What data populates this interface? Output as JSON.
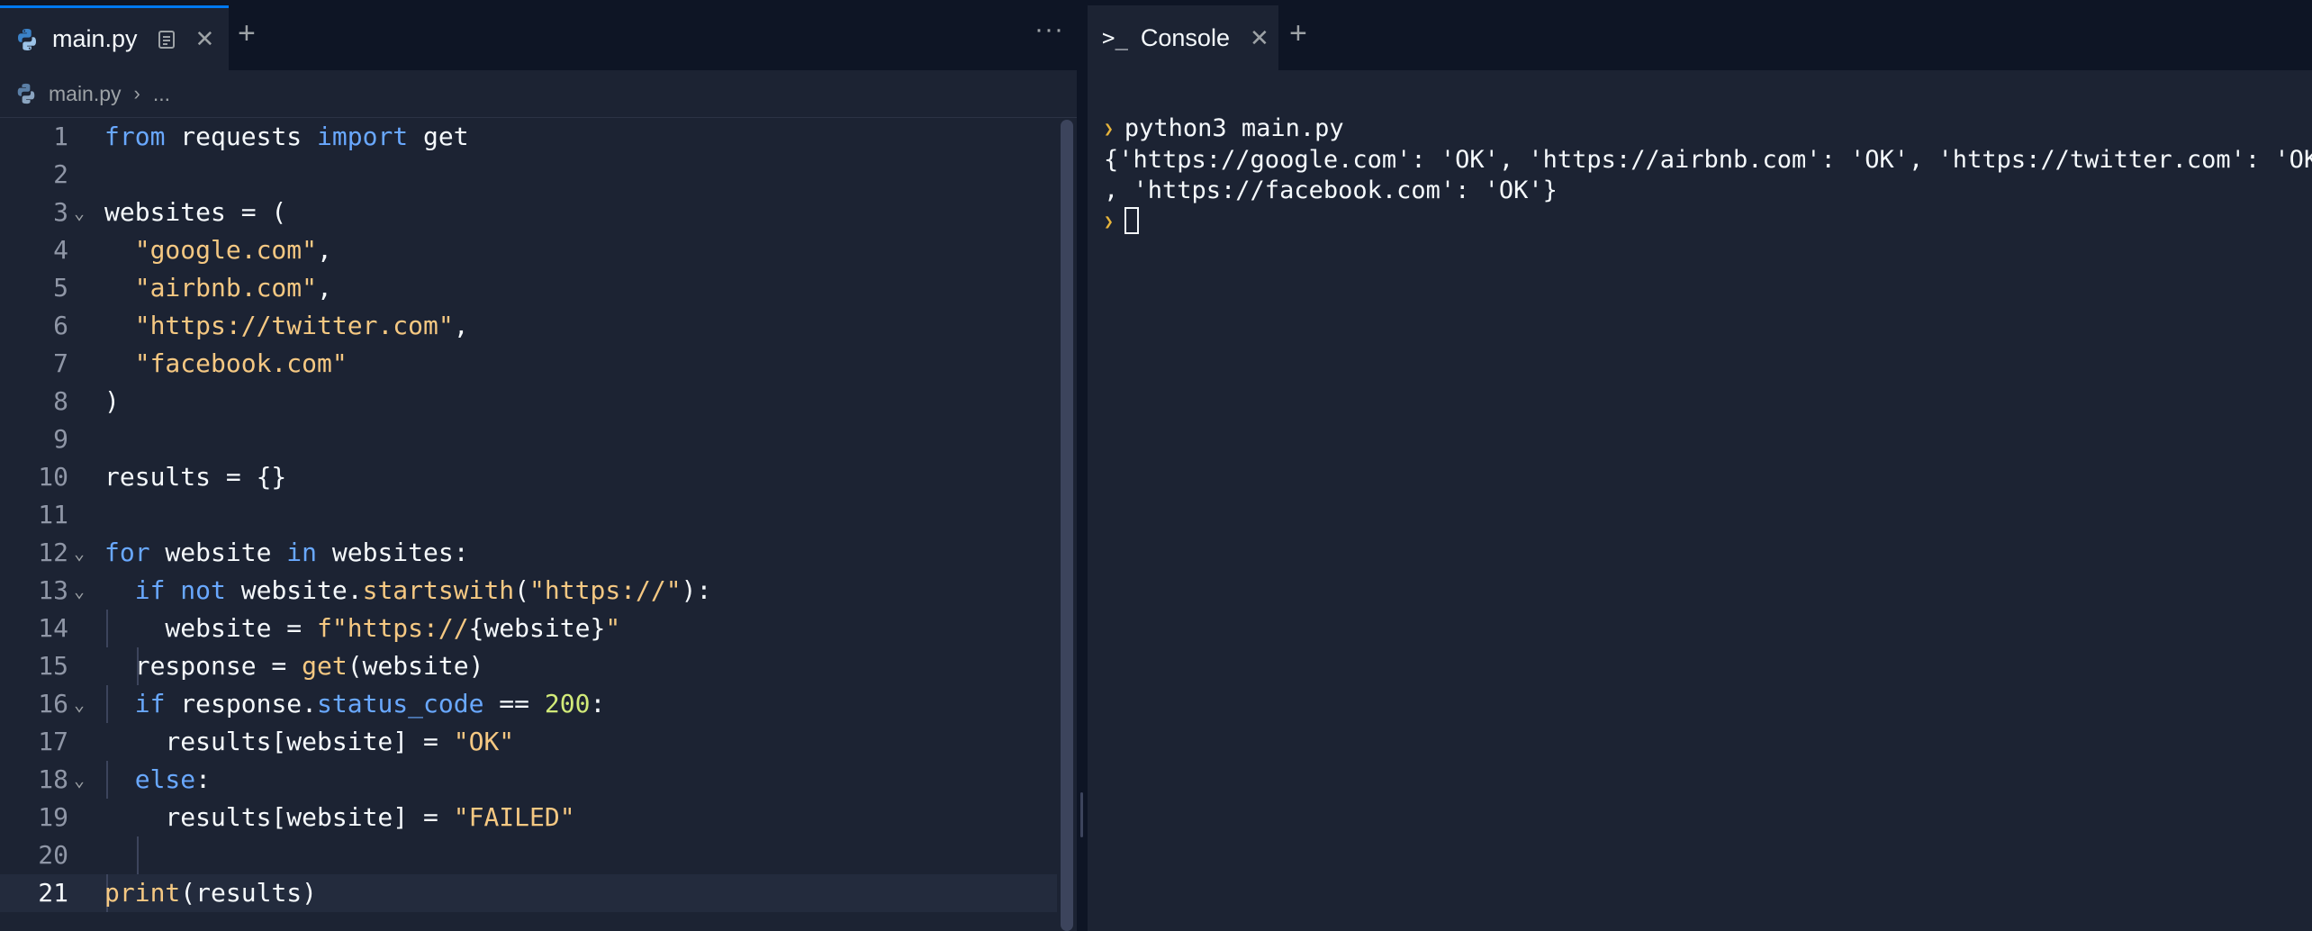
{
  "editor": {
    "tab": {
      "label": "main.py",
      "icon": "python-icon"
    },
    "more_label": "···",
    "breadcrumb": {
      "file": "main.py",
      "rest": "..."
    }
  },
  "console": {
    "tab": {
      "label": "Console"
    },
    "command": "python3 main.py",
    "output_line1": "{'https://google.com': 'OK', 'https://airbnb.com': 'OK', 'https://twitter.com': 'OK'",
    "output_line2": ", 'https://facebook.com': 'OK'}"
  },
  "code_lines": [
    {
      "n": "1",
      "tokens": [
        {
          "t": "from",
          "k": "kw"
        },
        {
          "t": " requests "
        },
        {
          "t": "import",
          "k": "kw"
        },
        {
          "t": " get"
        }
      ]
    },
    {
      "n": "2",
      "tokens": []
    },
    {
      "n": "3",
      "fold": true,
      "tokens": [
        {
          "t": "websites = ("
        }
      ]
    },
    {
      "n": "4",
      "tokens": [
        {
          "t": "  "
        },
        {
          "t": "\"google.com\"",
          "k": "str"
        },
        {
          "t": ","
        }
      ]
    },
    {
      "n": "5",
      "tokens": [
        {
          "t": "  "
        },
        {
          "t": "\"airbnb.com\"",
          "k": "str"
        },
        {
          "t": ","
        }
      ]
    },
    {
      "n": "6",
      "tokens": [
        {
          "t": "  "
        },
        {
          "t": "\"https://twitter.com\"",
          "k": "str"
        },
        {
          "t": ","
        }
      ]
    },
    {
      "n": "7",
      "tokens": [
        {
          "t": "  "
        },
        {
          "t": "\"facebook.com\"",
          "k": "str"
        }
      ]
    },
    {
      "n": "8",
      "tokens": [
        {
          "t": ")"
        }
      ]
    },
    {
      "n": "9",
      "tokens": []
    },
    {
      "n": "10",
      "tokens": [
        {
          "t": "results = {}"
        }
      ]
    },
    {
      "n": "11",
      "tokens": []
    },
    {
      "n": "12",
      "fold": true,
      "tokens": [
        {
          "t": "for",
          "k": "kw"
        },
        {
          "t": " website "
        },
        {
          "t": "in",
          "k": "kw"
        },
        {
          "t": " websites:"
        }
      ]
    },
    {
      "n": "13",
      "fold": true,
      "tokens": [
        {
          "t": "  "
        },
        {
          "t": "if",
          "k": "kw"
        },
        {
          "t": " "
        },
        {
          "t": "not",
          "k": "kw"
        },
        {
          "t": " website."
        },
        {
          "t": "startswith",
          "k": "fn"
        },
        {
          "t": "("
        },
        {
          "t": "\"https://\"",
          "k": "str"
        },
        {
          "t": "):"
        }
      ]
    },
    {
      "n": "14",
      "tokens": [
        {
          "t": "    website = "
        },
        {
          "t": "f\"https://",
          "k": "str"
        },
        {
          "t": "{website}"
        },
        {
          "t": "\"",
          "k": "str"
        }
      ]
    },
    {
      "n": "15",
      "tokens": [
        {
          "t": "  response = "
        },
        {
          "t": "get",
          "k": "fn"
        },
        {
          "t": "(website)"
        }
      ]
    },
    {
      "n": "16",
      "fold": true,
      "tokens": [
        {
          "t": "  "
        },
        {
          "t": "if",
          "k": "kw"
        },
        {
          "t": " response."
        },
        {
          "t": "status_code",
          "k": "kw"
        },
        {
          "t": " == "
        },
        {
          "t": "200",
          "k": "num"
        },
        {
          "t": ":"
        }
      ]
    },
    {
      "n": "17",
      "tokens": [
        {
          "t": "    results[website] = "
        },
        {
          "t": "\"OK\"",
          "k": "str"
        }
      ]
    },
    {
      "n": "18",
      "fold": true,
      "tokens": [
        {
          "t": "  "
        },
        {
          "t": "else",
          "k": "kw"
        },
        {
          "t": ":"
        }
      ]
    },
    {
      "n": "19",
      "tokens": [
        {
          "t": "    results[website] = "
        },
        {
          "t": "\"FAILED\"",
          "k": "str"
        }
      ]
    },
    {
      "n": "20",
      "tokens": []
    },
    {
      "n": "21",
      "current": true,
      "tokens": [
        {
          "t": "print",
          "k": "fn"
        },
        {
          "t": "(results)"
        }
      ]
    }
  ],
  "colors": {
    "background": "#1c2333",
    "tabbar": "#0e1525",
    "accent": "#0079f2",
    "keyword": "#69a8ff",
    "string": "#f5c882",
    "number": "#d1ea79",
    "prompt": "#e6b43c"
  }
}
